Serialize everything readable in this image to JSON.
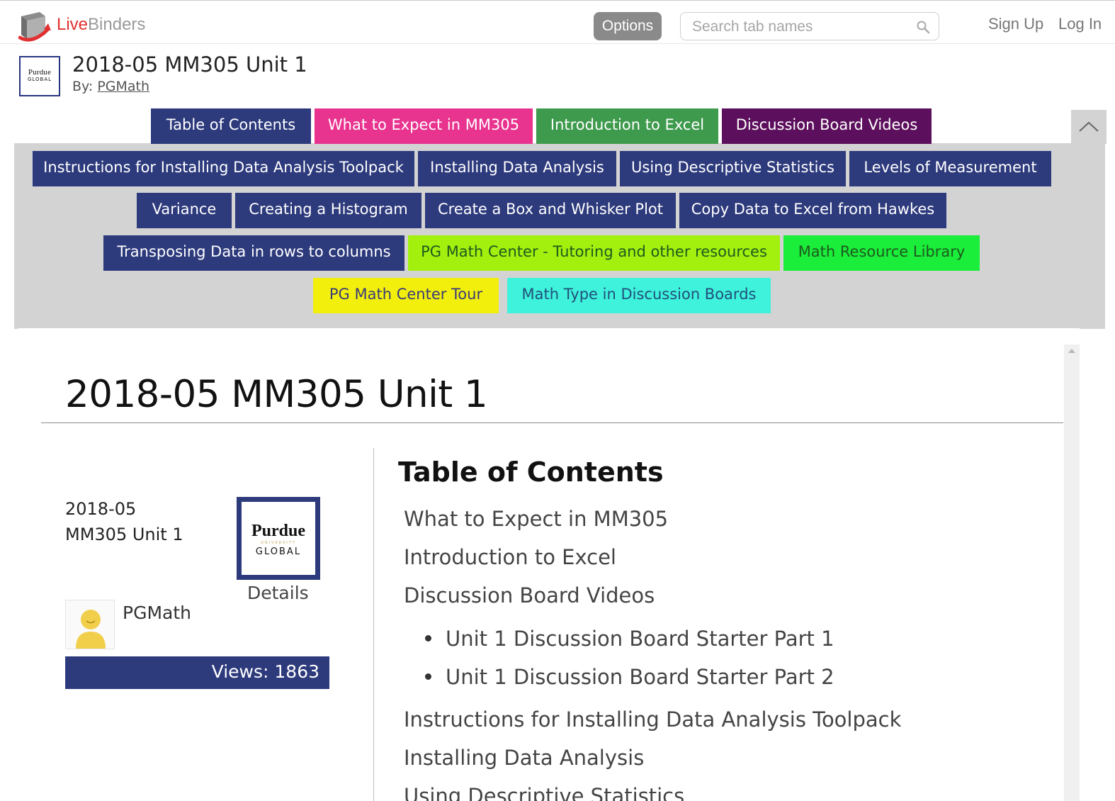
{
  "header": {
    "brand_live": "Live",
    "brand_binders": "Binders",
    "options_label": "Options",
    "search_placeholder": "Search tab names",
    "signup_label": "Sign Up",
    "login_label": "Log In"
  },
  "binder": {
    "title": "2018-05 MM305 Unit 1",
    "by_prefix": "By: ",
    "author": "PGMath",
    "thumb_logo_top": "Purdue",
    "thumb_logo_bottom": "GLOBAL"
  },
  "tabs": {
    "row0": [
      {
        "label": "Table of Contents",
        "color": "#2d3a7c"
      },
      {
        "label": "What to Expect in MM305",
        "color": "#e8338f"
      },
      {
        "label": "Introduction to Excel",
        "color": "#3e9a4d"
      },
      {
        "label": "Discussion Board Videos",
        "color": "#5c0f5c"
      }
    ],
    "row1": [
      {
        "label": "Instructions for Installing Data Analysis Toolpack",
        "color": "#2d3a7c"
      },
      {
        "label": "Installing Data Analysis",
        "color": "#2d3a7c"
      },
      {
        "label": "Using Descriptive Statistics",
        "color": "#2d3a7c"
      },
      {
        "label": "Levels of Measurement",
        "color": "#2d3a7c"
      }
    ],
    "row2": [
      {
        "label": "Variance",
        "color": "#2d3a7c"
      },
      {
        "label": "Creating a Histogram",
        "color": "#2d3a7c"
      },
      {
        "label": "Create a Box and Whisker Plot",
        "color": "#2d3a7c"
      },
      {
        "label": "Copy Data to Excel from Hawkes",
        "color": "#2d3a7c"
      }
    ],
    "row3": [
      {
        "label": "Transposing Data in rows to columns",
        "color": "#2d3a7c"
      },
      {
        "label": "PG Math Center - Tutoring and other resources",
        "color": "#a3f00f"
      },
      {
        "label": "Math Resource Library",
        "color": "#1aed3a"
      }
    ],
    "row4": [
      {
        "label": "PG Math Center Tour",
        "color": "#f2ef0c"
      },
      {
        "label": "Math Type in Discussion Boards",
        "color": "#3ef2dc"
      }
    ]
  },
  "content": {
    "page_title": "2018-05 MM305 Unit 1",
    "side_line1": "2018-05",
    "side_line2": "MM305 Unit 1",
    "logo_top": "Purdue",
    "logo_mid": "UNIVERSITY",
    "logo_bottom": "GLOBAL",
    "details_label": "Details",
    "author": "PGMath",
    "views": "Views: 1863",
    "toc_heading": "Table of Contents",
    "toc": [
      "What to Expect in MM305",
      "Introduction to Excel",
      "Discussion Board Videos",
      "Unit 1 Discussion Board Starter Part 1",
      "Unit 1 Discussion Board Starter Part 2",
      "Instructions for Installing Data Analysis Toolpack",
      "Installing Data Analysis",
      "Using Descriptive Statistics"
    ]
  }
}
